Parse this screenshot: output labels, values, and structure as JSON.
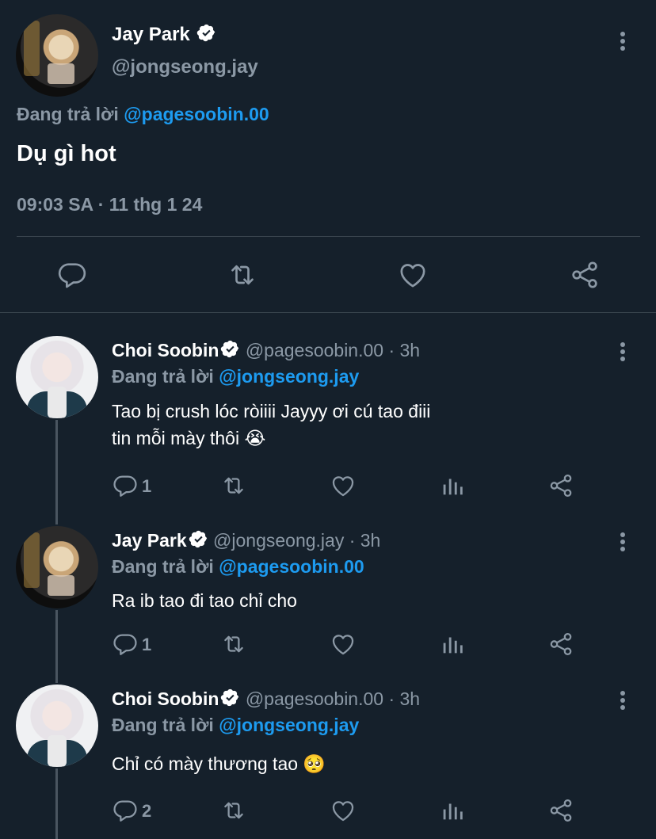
{
  "main_tweet": {
    "author": {
      "name": "Jay Park",
      "handle": "@jongseong.jay"
    },
    "reply_prefix": "Đang trả lời",
    "reply_to": "@pagesoobin.00",
    "text": "Dụ gì hot",
    "timestamp": "09:03 SA · 11 thg 1 24"
  },
  "replies": [
    {
      "author": {
        "name": "Choi Soobin",
        "handle": "@pagesoobin.00"
      },
      "time": "· 3h",
      "reply_prefix": "Đang trả lời",
      "reply_to": "@jongseong.jay",
      "text_line1": "Tao bị crush lóc ròiiii Jayyy ơi cú tao điii",
      "text_line2": "tin mỗi mày thôi 😭",
      "reply_count": "1"
    },
    {
      "author": {
        "name": "Jay Park",
        "handle": "@jongseong.jay"
      },
      "time": "· 3h",
      "reply_prefix": "Đang trả lời",
      "reply_to": "@pagesoobin.00",
      "text_line1": "Ra ib tao đi tao chỉ cho",
      "reply_count": "1"
    },
    {
      "author": {
        "name": "Choi Soobin",
        "handle": "@pagesoobin.00"
      },
      "time": "· 3h",
      "reply_prefix": "Đang trả lời",
      "reply_to": "@jongseong.jay",
      "text_line1": "Chỉ có mày thương tao 🥺",
      "reply_count": "2"
    }
  ],
  "icons": {
    "reply": "reply-icon",
    "retweet": "retweet-icon",
    "like": "heart-icon",
    "views": "views-icon",
    "share": "share-icon",
    "verified": "verified-badge-icon",
    "more": "more-icon"
  },
  "colors": {
    "background": "#15202b",
    "accent": "#1d9bf0",
    "muted": "#8b98a5",
    "divider": "#38444d"
  }
}
